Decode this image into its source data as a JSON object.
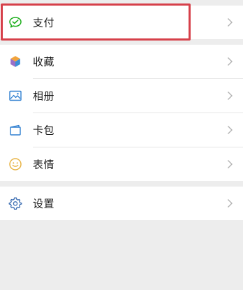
{
  "menu": {
    "items": [
      {
        "id": "pay",
        "label": "支付",
        "icon": "wechat-pay-icon"
      },
      {
        "id": "favorites",
        "label": "收藏",
        "icon": "favorites-cube-icon"
      },
      {
        "id": "album",
        "label": "相册",
        "icon": "album-picture-icon"
      },
      {
        "id": "cards",
        "label": "卡包",
        "icon": "card-wallet-icon"
      },
      {
        "id": "stickers",
        "label": "表情",
        "icon": "smiley-icon"
      },
      {
        "id": "settings",
        "label": "设置",
        "icon": "gear-icon"
      }
    ]
  },
  "colors": {
    "background": "#ededed",
    "row": "#ffffff",
    "highlight_border": "#d6404a",
    "pay_icon": "#1aad19",
    "gear_icon": "#3e6fb3",
    "smiley_icon": "#e8b446"
  }
}
